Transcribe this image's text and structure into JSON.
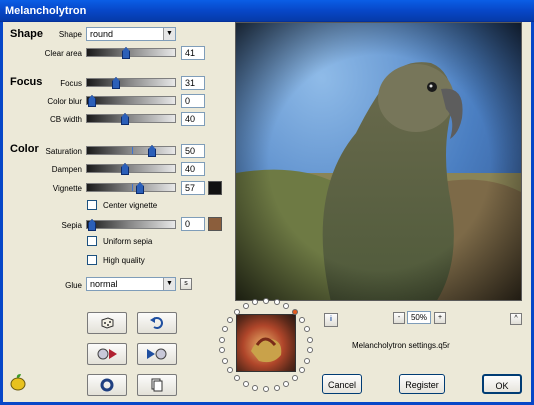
{
  "window": {
    "title": "Melancholytron"
  },
  "shape": {
    "heading": "Shape",
    "shape_label": "Shape",
    "shape_value": "round",
    "clear_area_label": "Clear area",
    "clear_area_value": "41"
  },
  "focus": {
    "heading": "Focus",
    "focus_label": "Focus",
    "focus_value": "31",
    "color_blur_label": "Color blur",
    "color_blur_value": "0",
    "cb_width_label": "CB width",
    "cb_width_value": "40"
  },
  "color": {
    "heading": "Color",
    "saturation_label": "Saturation",
    "saturation_value": "50",
    "dampen_label": "Dampen",
    "dampen_value": "40",
    "vignette_label": "Vignette",
    "vignette_value": "57",
    "vignette_color": "#111111",
    "center_vignette_label": "Center vignette",
    "sepia_label": "Sepia",
    "sepia_value": "0",
    "sepia_color": "#8b5e3c",
    "uniform_sepia_label": "Uniform sepia",
    "high_quality_label": "High quality"
  },
  "glue": {
    "label": "Glue",
    "value": "normal",
    "s_button": "s"
  },
  "preview": {
    "info_button": "i",
    "zoom_minus": "-",
    "zoom_value": "50%",
    "zoom_plus": "+",
    "collapse_button": "^",
    "settings_file": "Melancholytron settings.q5r"
  },
  "buttons": {
    "cancel": "Cancel",
    "register": "Register",
    "ok": "OK"
  },
  "icons": {
    "dice": "dice-icon",
    "undo": "undo-icon",
    "play_left": "play-left-icon",
    "play_right": "play-right-icon",
    "record": "circle-icon",
    "copy": "copy-icon",
    "logo": "fruit-logo-icon"
  }
}
